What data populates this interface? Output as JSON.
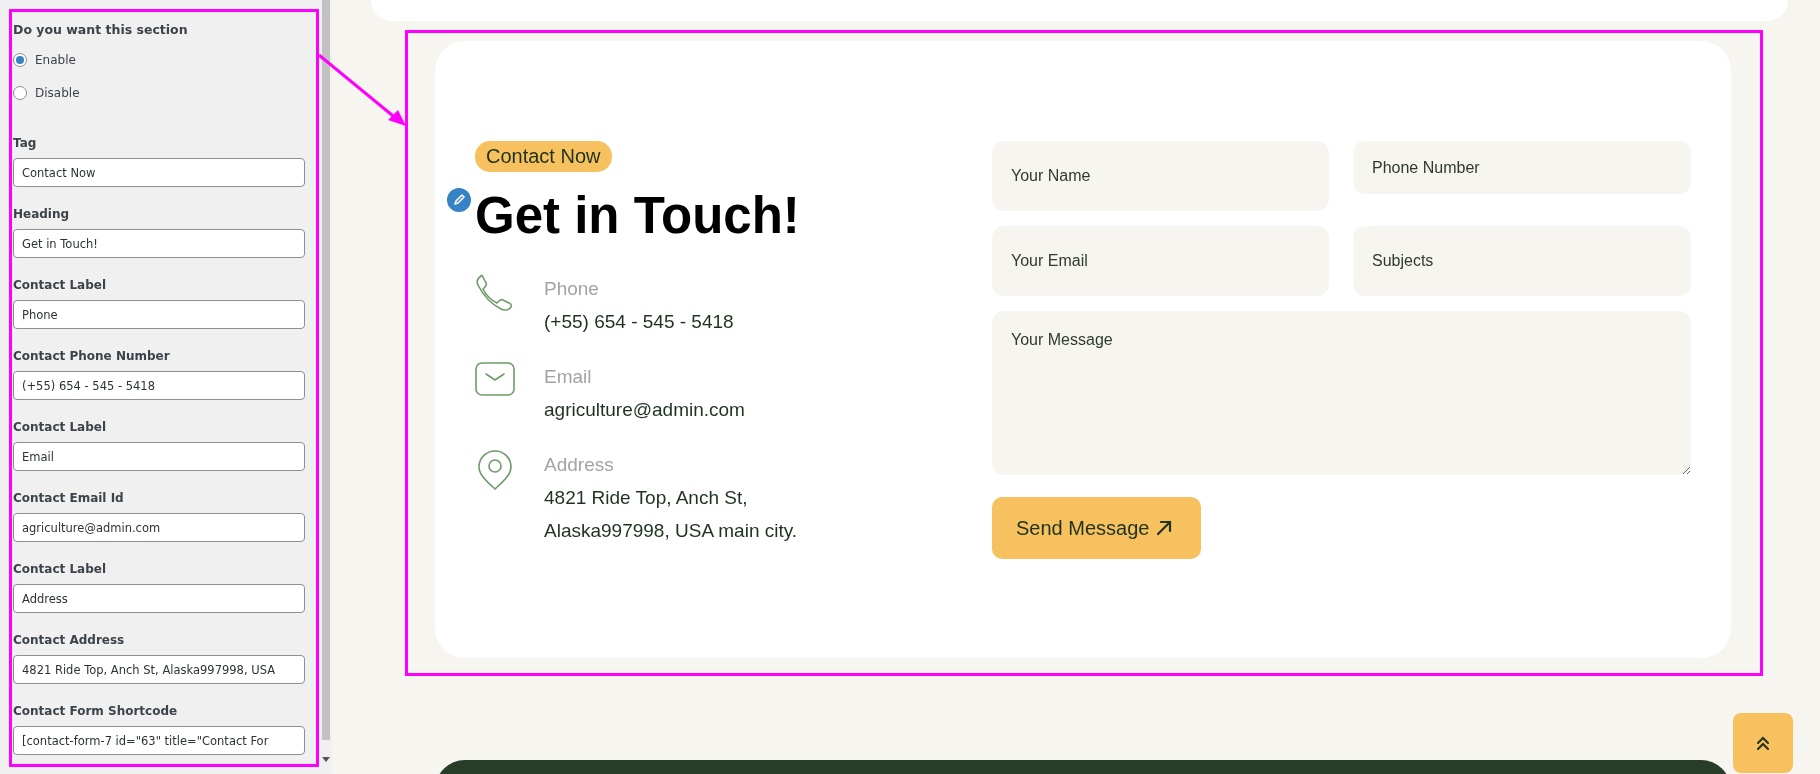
{
  "settings_panel": {
    "question": "Do you want this section",
    "options": [
      {
        "label": "Enable",
        "selected": true
      },
      {
        "label": "Disable",
        "selected": false
      }
    ],
    "fields": [
      {
        "label": "Tag",
        "value": "Contact Now"
      },
      {
        "label": "Heading",
        "value": "Get in Touch!"
      },
      {
        "label": "Contact Label",
        "value": "Phone"
      },
      {
        "label": "Contact Phone Number",
        "value": "(+55) 654 - 545 - 5418"
      },
      {
        "label": "Contact Label",
        "value": "Email"
      },
      {
        "label": "Contact Email Id",
        "value": "agriculture@admin.com"
      },
      {
        "label": "Contact Label",
        "value": "Address"
      },
      {
        "label": "Contact Address",
        "value": "4821 Ride Top, Anch St, Alaska997998, USA"
      },
      {
        "label": "Contact Form Shortcode",
        "value": "[contact-form-7 id=\"63\" title=\"Contact For"
      }
    ]
  },
  "section": {
    "tag": "Contact Now",
    "heading": "Get in Touch!",
    "contacts": [
      {
        "kind": "phone",
        "label": "Phone",
        "value": "(+55) 654 - 545 - 5418"
      },
      {
        "kind": "email",
        "label": "Email",
        "value": "agriculture@admin.com"
      },
      {
        "kind": "address",
        "label": "Address",
        "value": "4821 Ride Top, Anch St, Alaska997998, USA main city."
      }
    ],
    "form": {
      "fields": [
        {
          "placeholder": "Your Name"
        },
        {
          "placeholder": "Phone Number"
        },
        {
          "placeholder": "Your Email"
        },
        {
          "placeholder": "Subjects"
        }
      ],
      "message_placeholder": "Your Message",
      "submit": "Send Message"
    }
  }
}
